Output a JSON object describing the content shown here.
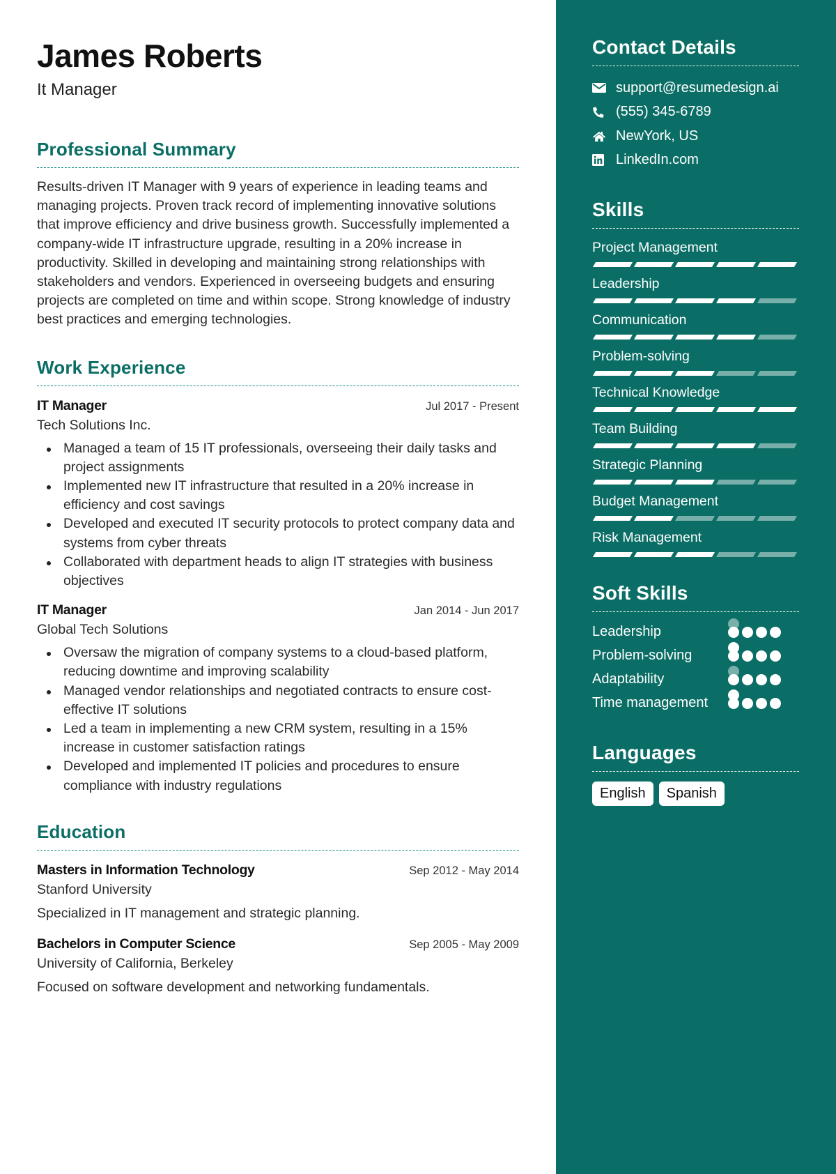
{
  "header": {
    "name": "James Roberts",
    "role": "It Manager"
  },
  "summary": {
    "title": "Professional Summary",
    "text": "Results-driven IT Manager with 9 years of experience in leading teams and managing projects. Proven track record of implementing innovative solutions that improve efficiency and drive business growth. Successfully implemented a company-wide IT infrastructure upgrade, resulting in a 20% increase in productivity. Skilled in developing and maintaining strong relationships with stakeholders and vendors. Experienced in overseeing budgets and ensuring projects are completed on time and within scope. Strong knowledge of industry best practices and emerging technologies."
  },
  "experience": {
    "title": "Work Experience",
    "jobs": [
      {
        "title": "IT Manager",
        "dates": "Jul 2017 - Present",
        "company": "Tech Solutions Inc.",
        "bullets": [
          "Managed a team of 15 IT professionals, overseeing their daily tasks and project assignments",
          "Implemented new IT infrastructure that resulted in a 20% increase in efficiency and cost savings",
          "Developed and executed IT security protocols to protect company data and systems from cyber threats",
          "Collaborated with department heads to align IT strategies with business objectives"
        ]
      },
      {
        "title": "IT Manager",
        "dates": "Jan 2014 - Jun 2017",
        "company": "Global Tech Solutions",
        "bullets": [
          "Oversaw the migration of company systems to a cloud-based platform, reducing downtime and improving scalability",
          "Managed vendor relationships and negotiated contracts to ensure cost-effective IT solutions",
          "Led a team in implementing a new CRM system, resulting in a 15% increase in customer satisfaction ratings",
          "Developed and implemented IT policies and procedures to ensure compliance with industry regulations"
        ]
      }
    ]
  },
  "education": {
    "title": "Education",
    "items": [
      {
        "degree": "Masters in Information Technology",
        "dates": "Sep 2012 - May 2014",
        "school": "Stanford University",
        "description": "Specialized in IT management and strategic planning."
      },
      {
        "degree": "Bachelors in Computer Science",
        "dates": "Sep 2005 - May 2009",
        "school": "University of California, Berkeley",
        "description": "Focused on software development and networking fundamentals."
      }
    ]
  },
  "contact": {
    "title": "Contact Details",
    "items": [
      {
        "icon": "envelope-icon",
        "text": "support@resumedesign.ai"
      },
      {
        "icon": "phone-icon",
        "text": "(555) 345-6789"
      },
      {
        "icon": "home-icon",
        "text": "NewYork, US"
      },
      {
        "icon": "linkedin-icon",
        "text": "LinkedIn.com"
      }
    ]
  },
  "skills": {
    "title": "Skills",
    "max": 5,
    "items": [
      {
        "name": "Project Management",
        "level": 5
      },
      {
        "name": "Leadership",
        "level": 4
      },
      {
        "name": "Communication",
        "level": 4
      },
      {
        "name": "Problem-solving",
        "level": 3
      },
      {
        "name": "Technical Knowledge",
        "level": 5
      },
      {
        "name": "Team Building",
        "level": 4
      },
      {
        "name": "Strategic Planning",
        "level": 3
      },
      {
        "name": "Budget Management",
        "level": 2
      },
      {
        "name": "Risk Management",
        "level": 3
      }
    ]
  },
  "soft_skills": {
    "title": "Soft Skills",
    "max": 5,
    "items": [
      {
        "name": "Leadership",
        "level": 4
      },
      {
        "name": "Problem-solving",
        "level": 5
      },
      {
        "name": "Adaptability",
        "level": 4
      },
      {
        "name": "Time management",
        "level": 5
      }
    ]
  },
  "languages": {
    "title": "Languages",
    "items": [
      "English",
      "Spanish"
    ]
  },
  "colors": {
    "accent": "#0b6e66",
    "sidebar_text": "#ffffff"
  }
}
